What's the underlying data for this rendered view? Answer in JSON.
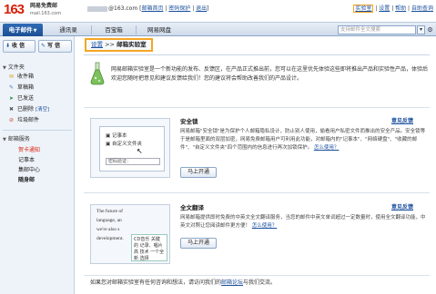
{
  "header": {
    "logo_number": "163",
    "brand_title": "网易免费邮",
    "brand_domain": "mail.163.com",
    "user_email_suffix": "@163.com",
    "user_links": [
      "邮箱首页",
      "密码保护",
      "退出"
    ],
    "top_links": [
      "实验室",
      "设置",
      "帮助",
      "自助查询"
    ]
  },
  "nav": {
    "tabs": [
      "电子邮件",
      "通讯录",
      "百宝箱",
      "网易网盘"
    ],
    "active_arrow": "▼",
    "search_placeholder": "支持邮件全文搜索",
    "search_button": "▾",
    "gear": "⚙"
  },
  "sidebar": {
    "receive_label": "收 信",
    "compose_label": "写 信",
    "folders_title": "文件夹",
    "folders": [
      {
        "label": "收件箱",
        "icon": "inbox-icon",
        "glyph": "✉"
      },
      {
        "label": "草稿箱",
        "icon": "drafts-icon",
        "glyph": "✎"
      },
      {
        "label": "已发送",
        "icon": "sent-icon",
        "glyph": "➤"
      },
      {
        "label": "已删除",
        "icon": "trash-icon",
        "glyph": "🗑",
        "sub": "[清空]"
      },
      {
        "label": "垃圾邮件",
        "icon": "spam-icon",
        "glyph": "⊘"
      }
    ],
    "apps_title": "邮箱服务",
    "apps": [
      "贺卡通知",
      "记事本",
      "集邮中心",
      "随身邮"
    ]
  },
  "breadcrumb": {
    "link": "设置",
    "sep": ">>",
    "current": "邮箱实验室"
  },
  "intro": {
    "text": "网易邮箱实验室是一个新功能的发布、反馈区，在产品正式推出前，您可以在这里优先体验这些即将推出产品和实验性产品，体验后欢迎您随时把意见和建议反馈给我们！您的建议将会帮助改善我们的产品设计。"
  },
  "features": [
    {
      "title": "安全锁",
      "feedback": "意见反馈",
      "description": "网易邮箱\"安全锁\"是为保护个人邮箱隐私设计，防止别人使用，偷看用户私密文件而推出的安全产品。安全锁等于是邮箱里面的双层加密，网易免费邮箱用户可利用此功能，对邮箱内的\"记事本\"、\"网络硬盘\"、\"收藏的邮件\"、\"自定义文件夹\"四个范围内的信息进行再次加锁保护。",
      "more": "怎么使用？",
      "button": "马上开通",
      "thumb": {
        "row1": "记事本",
        "row2": "自定义文件夹",
        "field": "密码验证："
      }
    },
    {
      "title": "全文翻译",
      "feedback": "意见反馈",
      "description": "网易邮箱提供即时免费的中英文全文翻译服务，当您的邮件中英文单词超过一定数量时，使用全文翻译功能，中英文对照让您阅读邮件更方便！",
      "more": "怎么使用？",
      "button": "马上开通",
      "thumb": {
        "lines": [
          "The future of",
          "language, an",
          "we're also s",
          "development."
        ],
        "popup": "CD音乐 关键 的 记录、唱片 高 技术 一个全 新 选择"
      }
    }
  ],
  "footer": {
    "prefix": "如果您对邮箱实验室有任何咨询和想法，请访问我们的",
    "link": "邮箱论坛",
    "suffix": "与我们交流。"
  }
}
